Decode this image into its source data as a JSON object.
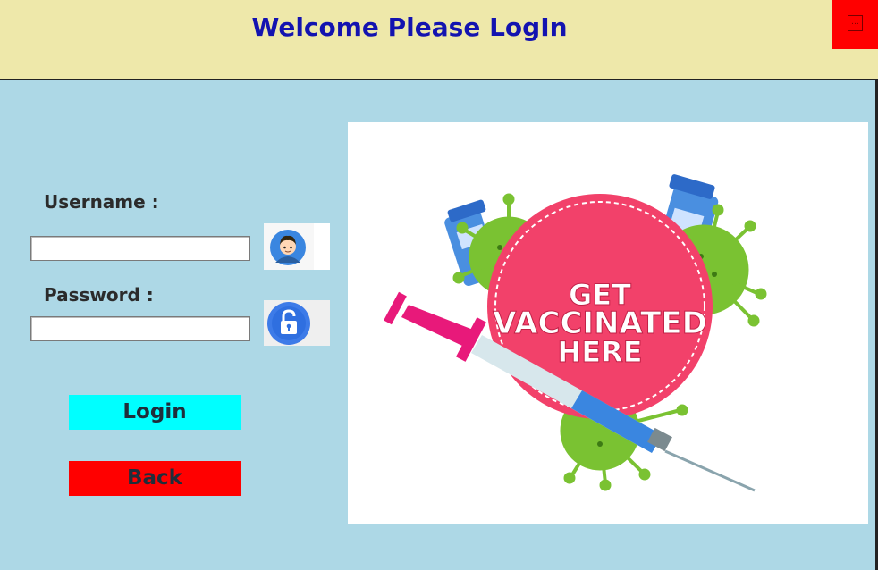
{
  "header": {
    "title": "Welcome Please LogIn"
  },
  "window": {
    "close_icon": "minimize-icon",
    "close_color": "#ff0000"
  },
  "form": {
    "username_label": "Username :",
    "username_value": "",
    "password_label": "Password :",
    "password_value": "",
    "user_icon": "user-avatar-icon",
    "lock_icon": "lock-icon"
  },
  "buttons": {
    "login_label": "Login",
    "login_color": "#00ffff",
    "back_label": "Back",
    "back_color": "#ff0000"
  },
  "poster": {
    "line1": "GET",
    "line2": "VACCINATED",
    "line3": "HERE"
  }
}
